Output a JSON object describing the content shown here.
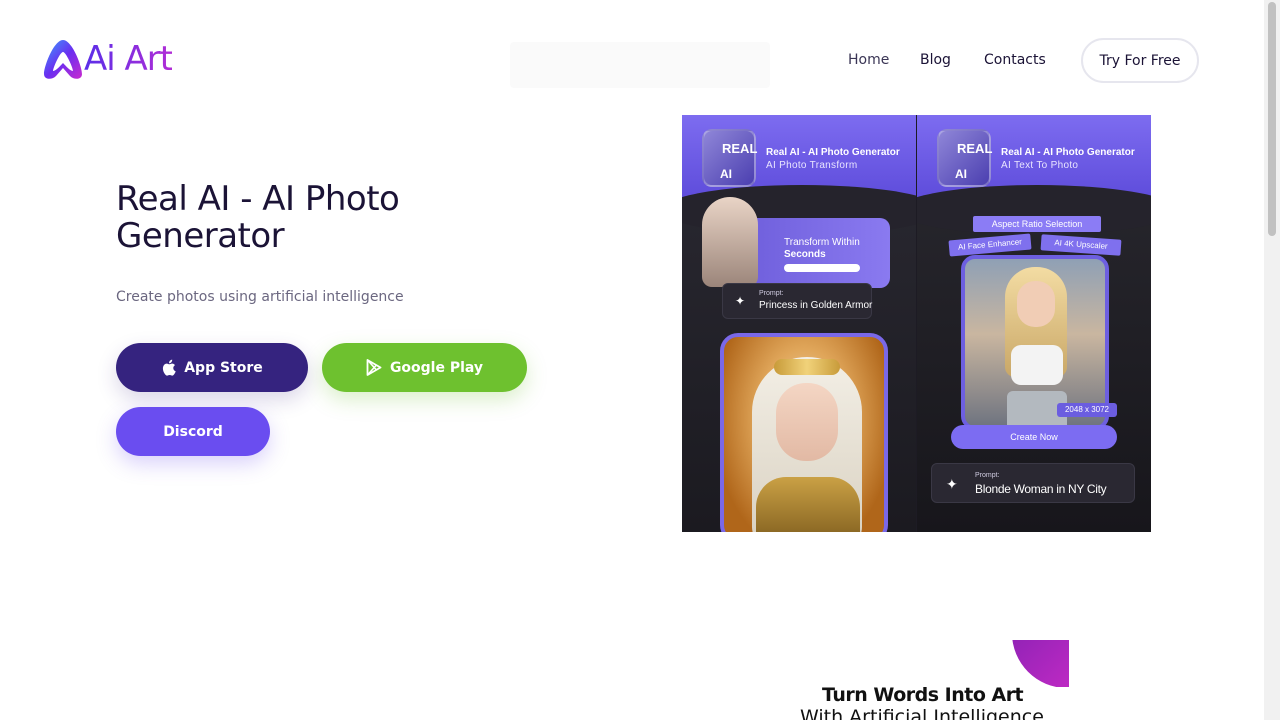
{
  "header": {
    "logo_text": "Ai Art",
    "nav": [
      {
        "label": "Home"
      },
      {
        "label": "Blog"
      },
      {
        "label": "Contacts"
      }
    ],
    "cta_label": "Try For Free"
  },
  "hero": {
    "title": "Real AI - AI Photo Generator",
    "subtitle": "Create photos using artificial intelligence",
    "buttons": {
      "app_store": "App Store",
      "google_play": "Google Play",
      "discord": "Discord"
    }
  },
  "promo": {
    "icon_line1": "REAL",
    "icon_line2": "AI",
    "left": {
      "app_title": "Real AI - AI Photo Generator",
      "app_sub": "AI Photo Transform",
      "transform_line1": "Transform Within",
      "transform_line2": "Seconds",
      "prompt_label": "Prompt:",
      "prompt_text": "Princess in Golden Armor"
    },
    "right": {
      "app_title": "Real AI - AI Photo Generator",
      "app_sub": "AI Text To Photo",
      "aspect_label": "Aspect Ratio Selection",
      "chip1": "AI Face Enhancer",
      "chip2": "AI 4K Upscaler",
      "size_badge": "2048 x 3072",
      "create_button": "Create Now",
      "prompt_label": "Prompt:",
      "prompt_text": "Blonde Woman in NY City"
    }
  },
  "banner": {
    "title": "Turn Words Into Art",
    "subtitle": "With Artificial Intelligence"
  },
  "colors": {
    "app_store": "#35237f",
    "google_play": "#6ec12f",
    "discord": "#6a4df0",
    "brand_gradient_start": "#5a2ee8",
    "brand_gradient_end": "#b12dd6"
  }
}
